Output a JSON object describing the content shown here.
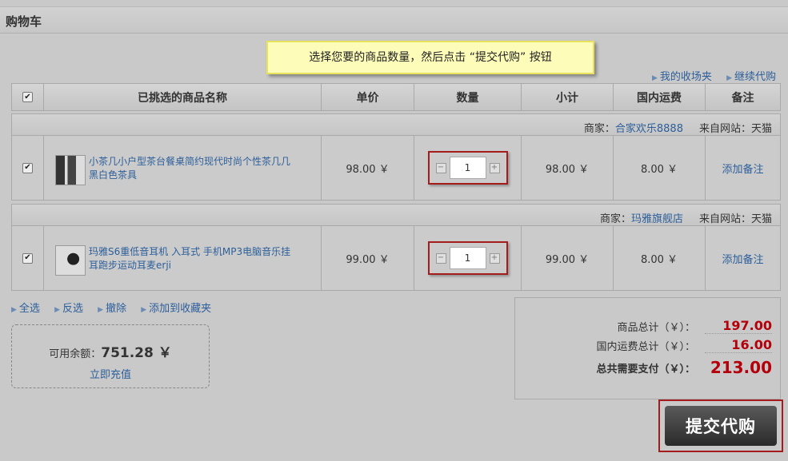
{
  "page": {
    "title": "购物车"
  },
  "tip": "选择您要的商品数量，然后点击 “提交代购” 按钮",
  "toplinks": {
    "favorites": "我的收场夹",
    "continue": "继续代购"
  },
  "table": {
    "headers": {
      "name": "已挑选的商品名称",
      "price": "单价",
      "qty": "数量",
      "subtotal": "小计",
      "shipping": "国内运费",
      "note": "备注"
    },
    "check_all_mark": "✔"
  },
  "items": [
    {
      "seller_label": "商家：",
      "seller": "合家欢乐8888",
      "source_label": "来自网站：",
      "source": "天猫",
      "checked_mark": "✔",
      "name": "小茶几小户型茶台餐桌简约现代时尚个性茶几几黑白色茶具",
      "price": "98.00 ￥",
      "qty": "1",
      "subtotal": "98.00 ￥",
      "shipping": "8.00 ￥",
      "note": "添加备注",
      "minus": "−",
      "plus": "+"
    },
    {
      "seller_label": "商家：",
      "seller": "玛雅旗舰店",
      "source_label": "来自网站：",
      "source": "天猫",
      "checked_mark": "✔",
      "name": "玛雅S6重低音耳机 入耳式 手机MP3电脑音乐挂耳跑步运动耳麦erji",
      "price": "99.00 ￥",
      "qty": "1",
      "subtotal": "99.00 ￥",
      "shipping": "8.00 ￥",
      "note": "添加备注",
      "minus": "−",
      "plus": "+"
    }
  ],
  "actions": {
    "select_all": "全选",
    "invert": "反选",
    "remove": "撤除",
    "add_favorites": "添加到收藏夹"
  },
  "balance": {
    "label": "可用余额：",
    "amount": "751.28 ￥",
    "recharge": "立即充值"
  },
  "summary": {
    "goods_label": "商品总计（￥）：",
    "goods": "197.00",
    "shipping_label": "国内运费总计（￥）：",
    "shipping": "16.00",
    "total_label": "总共需要支付（￥）：",
    "total": "213.00"
  },
  "submit": "提交代购",
  "colors": {
    "price_red": "#b3000b",
    "link_blue": "#2d5f9a",
    "highlight_border": "#a51c1c",
    "tip_bg": "#fefcb9"
  }
}
